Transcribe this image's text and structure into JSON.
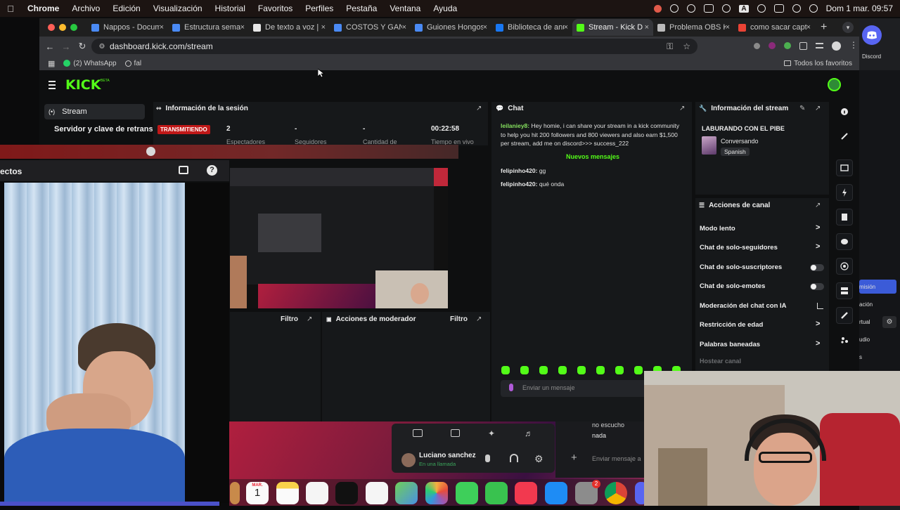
{
  "menubar": {
    "app": "Chrome",
    "items": [
      "Archivo",
      "Edición",
      "Visualización",
      "Historial",
      "Favoritos",
      "Perfiles",
      "Pestaña",
      "Ventana",
      "Ayuda"
    ],
    "clock": "Dom 1 mar.  09:57",
    "input_letter": "A"
  },
  "browser": {
    "tabs": [
      {
        "label": "Nappos - Documen",
        "favicon_color": "#4a8af4"
      },
      {
        "label": "Estructura semanal",
        "favicon_color": "#4a8af4"
      },
      {
        "label": "De texto a voz | Ele",
        "favicon_color": "#e8e8e8"
      },
      {
        "label": "COSTOS Y GANANC",
        "favicon_color": "#4a8af4"
      },
      {
        "label": "Guiones Hongos - D",
        "favicon_color": "#4a8af4"
      },
      {
        "label": "Biblioteca de anunc",
        "favicon_color": "#1877f2"
      },
      {
        "label": "Stream - Kick D",
        "favicon_color": "#53fc18"
      },
      {
        "label": "Problema OBS Kick",
        "favicon_color": "#bbbbbb"
      },
      {
        "label": "como sacar captura",
        "favicon_color": "#ea4335"
      }
    ],
    "url": "dashboard.kick.com/stream",
    "bookmarks": {
      "whatsapp": "(2) WhatsApp",
      "fal": "fal",
      "all_favorites": "Todos los favoritos"
    }
  },
  "discord": {
    "label": "Discord",
    "side_items": [
      "misión",
      "ación",
      "rtual",
      "udio",
      "s"
    ]
  },
  "kick": {
    "logo": "KICK",
    "beta": "BETA",
    "sidebar": {
      "stream": "Stream",
      "keys": "Servidor y clave de retransmisión"
    },
    "session": {
      "title": "Información de la sesión",
      "status": "TRANSMITIENDO",
      "stats": [
        {
          "value": "2",
          "label": "Espectadores"
        },
        {
          "value": "-",
          "label": "Seguidores"
        },
        {
          "value": "-",
          "label": "Cantidad de"
        },
        {
          "value": "00:22:58",
          "label": "Tiempo en vivo"
        }
      ]
    },
    "chat": {
      "title": "Chat",
      "messages": [
        {
          "user": "leilaniey8:",
          "text": "Hey homie, i can share your stream in a kick community to help you hit 200 followers and 800 viewers and also earn $1,500 per stream, add me on discord>>> success_222"
        },
        {
          "user": "felipinho420:",
          "text": "gg"
        },
        {
          "user": "felipinho420:",
          "text": "qué onda"
        }
      ],
      "new_messages": "Nuevos mensajes",
      "input_placeholder": "Enviar un mensaje"
    },
    "stream_info": {
      "title": "Información del stream",
      "stream_title": "LABURANDO CON EL PIBE",
      "category": "Conversando",
      "language": "Spanish"
    },
    "channel_actions": {
      "title": "Acciones de canal",
      "items": [
        {
          "label": "Modo lento",
          "control": "chevron"
        },
        {
          "label": "Chat de solo-seguidores",
          "control": "chevron"
        },
        {
          "label": "Chat de solo-suscriptores",
          "control": "toggle"
        },
        {
          "label": "Chat de solo-emotes",
          "control": "toggle"
        },
        {
          "label": "Moderación del chat con IA",
          "control": "chart"
        },
        {
          "label": "Restricción de edad",
          "control": "chevron"
        },
        {
          "label": "Palabras baneadas",
          "control": "chevron"
        }
      ],
      "host_label": "Hostear canal"
    },
    "mod_actions": {
      "title": "Acciones de moderador",
      "filter": "Filtro",
      "left_filter": "Filtro"
    }
  },
  "overlay": {
    "left_title": "ectos"
  },
  "discord_call": {
    "user": "Luciano sanchez",
    "status": "En una llamada",
    "chat_lines": [
      "no escucho",
      "nada"
    ],
    "input_placeholder": "Enviar mensaje a"
  },
  "dock": {
    "calendar_month": "MAR.",
    "calendar_day": "1",
    "badge": "2"
  }
}
